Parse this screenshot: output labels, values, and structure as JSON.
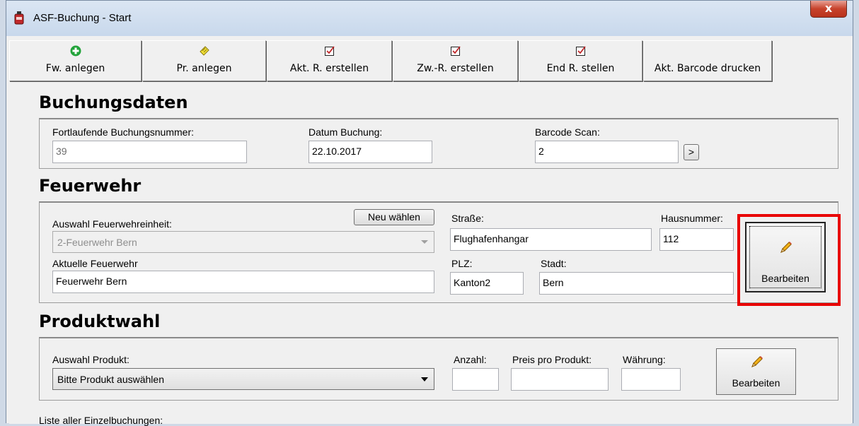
{
  "window": {
    "title": "ASF-Buchung - Start",
    "close_glyph": "x"
  },
  "toolbar": [
    {
      "label": "Fw. anlegen",
      "icon": "green-plus-icon"
    },
    {
      "label": "Pr. anlegen",
      "icon": "notepad-icon"
    },
    {
      "label": "Akt. R. erstellen",
      "icon": "checkbox-icon"
    },
    {
      "label": "Zw.-R. erstellen",
      "icon": "checkbox-icon"
    },
    {
      "label": "End R. stellen",
      "icon": "checkbox-icon"
    },
    {
      "label": "Akt. Barcode drucken",
      "icon": ""
    }
  ],
  "buchungsdaten": {
    "title": "Buchungsdaten",
    "nummer_label": "Fortlaufende Buchungsnummer:",
    "nummer_value": "39",
    "datum_label": "Datum Buchung:",
    "datum_value": "22.10.2017",
    "barcode_label": "Barcode Scan:",
    "barcode_value": "2",
    "barcode_button": ">"
  },
  "feuerwehr": {
    "title": "Feuerwehr",
    "auswahl_label": "Auswahl Feuerwehreinheit:",
    "neu_button": "Neu wählen",
    "auswahl_value": "2-Feuerwehr Bern",
    "aktuelle_label": "Aktuelle Feuerwehr",
    "aktuelle_value": "Feuerwehr Bern",
    "strasse_label": "Straße:",
    "strasse_value": "Flughafenhangar",
    "hausnummer_label": "Hausnummer:",
    "hausnummer_value": "112",
    "plz_label": "PLZ:",
    "plz_value": "Kanton2",
    "stadt_label": "Stadt:",
    "stadt_value": "Bern",
    "bearbeiten_button": "Bearbeiten"
  },
  "produktwahl": {
    "title": "Produktwahl",
    "auswahl_label": "Auswahl Produkt:",
    "auswahl_value": "Bitte Produkt auswählen",
    "anzahl_label": "Anzahl:",
    "anzahl_value": "",
    "preis_label": "Preis pro Produkt:",
    "preis_value": "",
    "waehrung_label": "Währung:",
    "waehrung_value": "",
    "bearbeiten_button": "Bearbeiten"
  },
  "liste_label": "Liste aller Einzelbuchungen:",
  "colors": {
    "highlight": "#e80000",
    "title_bar": "#c8d8ec",
    "close_button": "#c7422b"
  }
}
